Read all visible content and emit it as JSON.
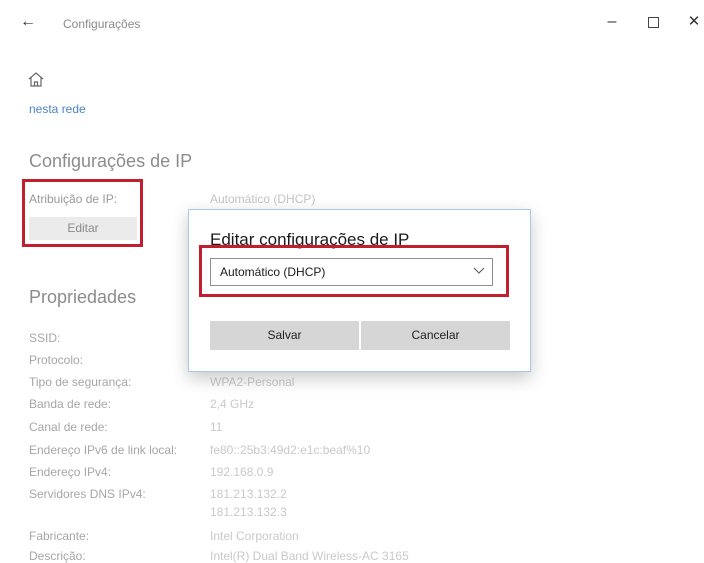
{
  "window": {
    "title": "Configurações",
    "icons": [
      "back-arrow-icon",
      "home-icon",
      "minimize-icon",
      "maximize-icon",
      "close-icon"
    ]
  },
  "nav": {
    "link": "nesta rede"
  },
  "ip_settings": {
    "heading": "Configurações de IP",
    "assignment_label": "Atribuição de IP:",
    "assignment_value": "Automático (DHCP)",
    "edit_button": "Editar"
  },
  "properties": {
    "heading": "Propriedades",
    "rows": [
      {
        "label": "SSID:",
        "value": ""
      },
      {
        "label": "Protocolo:",
        "value": ""
      },
      {
        "label": "Tipo de segurança:",
        "value": "WPA2-Personal"
      },
      {
        "label": "Banda de rede:",
        "value": "2,4 GHz"
      },
      {
        "label": "Canal de rede:",
        "value": "11"
      },
      {
        "label": "Endereço IPv6 de link local:",
        "value": "fe80::25b3:49d2:e1c:beaf%10"
      },
      {
        "label": "Endereço IPv4:",
        "value": "192.168.0.9"
      },
      {
        "label": "Servidores DNS IPv4:",
        "value": "181.213.132.2",
        "value2": "181.213.132.3"
      },
      {
        "label": "Fabricante:",
        "value": "Intel Corporation"
      },
      {
        "label": "Descrição:",
        "value": "Intel(R) Dual Band Wireless-AC 3165"
      }
    ]
  },
  "dialog": {
    "title": "Editar configurações de IP",
    "select_value": "Automático (DHCP)",
    "save_button": "Salvar",
    "cancel_button": "Cancelar"
  },
  "colors": {
    "highlight": "#c0202e",
    "link": "#4a86c8",
    "dialog_border": "#a9c9ea"
  }
}
